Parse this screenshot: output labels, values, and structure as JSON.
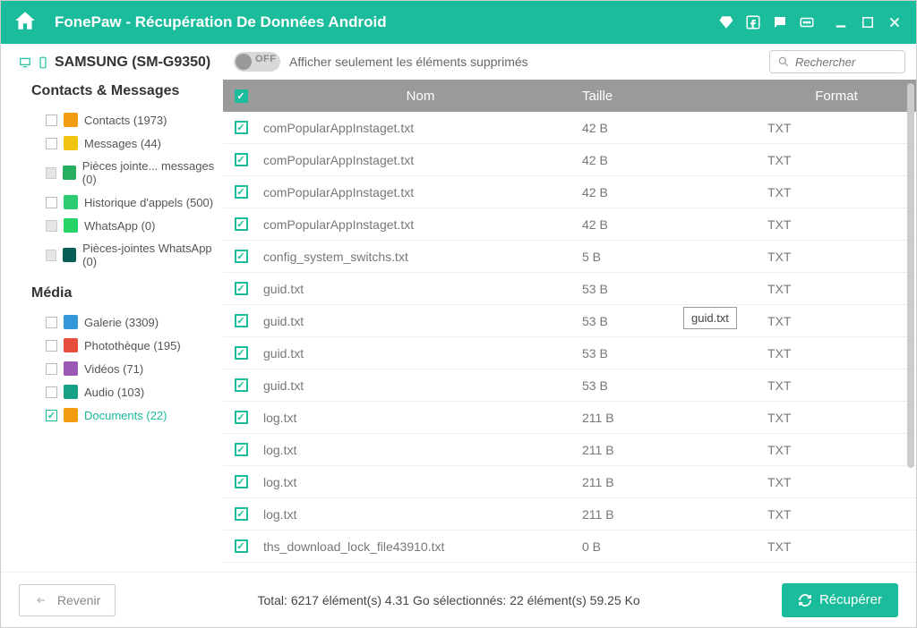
{
  "titlebar": {
    "title": "FonePaw - Récupération De Données Android"
  },
  "sidebar": {
    "device": "SAMSUNG (SM-G9350)",
    "section1": "Contacts & Messages",
    "section2": "Média",
    "items1": [
      {
        "label": "Contacts (1973)",
        "icon_bg": "#f39c12"
      },
      {
        "label": "Messages (44)",
        "icon_bg": "#f1c40f"
      },
      {
        "label": "Pièces jointe... messages (0)",
        "icon_bg": "#27ae60",
        "disabled": true
      },
      {
        "label": "Historique d'appels (500)",
        "icon_bg": "#2ecc71"
      },
      {
        "label": "WhatsApp (0)",
        "icon_bg": "#25d366",
        "disabled": true
      },
      {
        "label": "Pièces-jointes WhatsApp (0)",
        "icon_bg": "#075e54",
        "disabled": true
      }
    ],
    "items2": [
      {
        "label": "Galerie (3309)",
        "icon_bg": "#3498db"
      },
      {
        "label": "Photothèque (195)",
        "icon_bg": "#e74c3c"
      },
      {
        "label": "Vidéos (71)",
        "icon_bg": "#9b59b6"
      },
      {
        "label": "Audio (103)",
        "icon_bg": "#16a085"
      },
      {
        "label": "Documents (22)",
        "icon_bg": "#f39c12",
        "active": true,
        "checked": true
      }
    ]
  },
  "toolbar": {
    "toggle_off": "OFF",
    "toggle_text": "Afficher seulement les éléments supprimés",
    "search_placeholder": "Rechercher"
  },
  "table": {
    "head_name": "Nom",
    "head_size": "Taille",
    "head_format": "Format",
    "rows": [
      {
        "name": "comPopularAppInstaget.txt",
        "size": "42 B",
        "format": "TXT"
      },
      {
        "name": "comPopularAppInstaget.txt",
        "size": "42 B",
        "format": "TXT"
      },
      {
        "name": "comPopularAppInstaget.txt",
        "size": "42 B",
        "format": "TXT"
      },
      {
        "name": "comPopularAppInstaget.txt",
        "size": "42 B",
        "format": "TXT"
      },
      {
        "name": "config_system_switchs.txt",
        "size": "5 B",
        "format": "TXT"
      },
      {
        "name": "guid.txt",
        "size": "53 B",
        "format": "TXT"
      },
      {
        "name": "guid.txt",
        "size": "53 B",
        "format": "TXT",
        "tooltip": "guid.txt"
      },
      {
        "name": "guid.txt",
        "size": "53 B",
        "format": "TXT"
      },
      {
        "name": "guid.txt",
        "size": "53 B",
        "format": "TXT"
      },
      {
        "name": "log.txt",
        "size": "211 B",
        "format": "TXT"
      },
      {
        "name": "log.txt",
        "size": "211 B",
        "format": "TXT"
      },
      {
        "name": "log.txt",
        "size": "211 B",
        "format": "TXT"
      },
      {
        "name": "log.txt",
        "size": "211 B",
        "format": "TXT"
      },
      {
        "name": "ths_download_lock_file43910.txt",
        "size": "0 B",
        "format": "TXT"
      }
    ]
  },
  "footer": {
    "back": "Revenir",
    "stats": "Total: 6217 élément(s) 4.31 Go   sélectionnés: 22 élément(s) 59.25 Ko",
    "recover": "Récupérer"
  }
}
